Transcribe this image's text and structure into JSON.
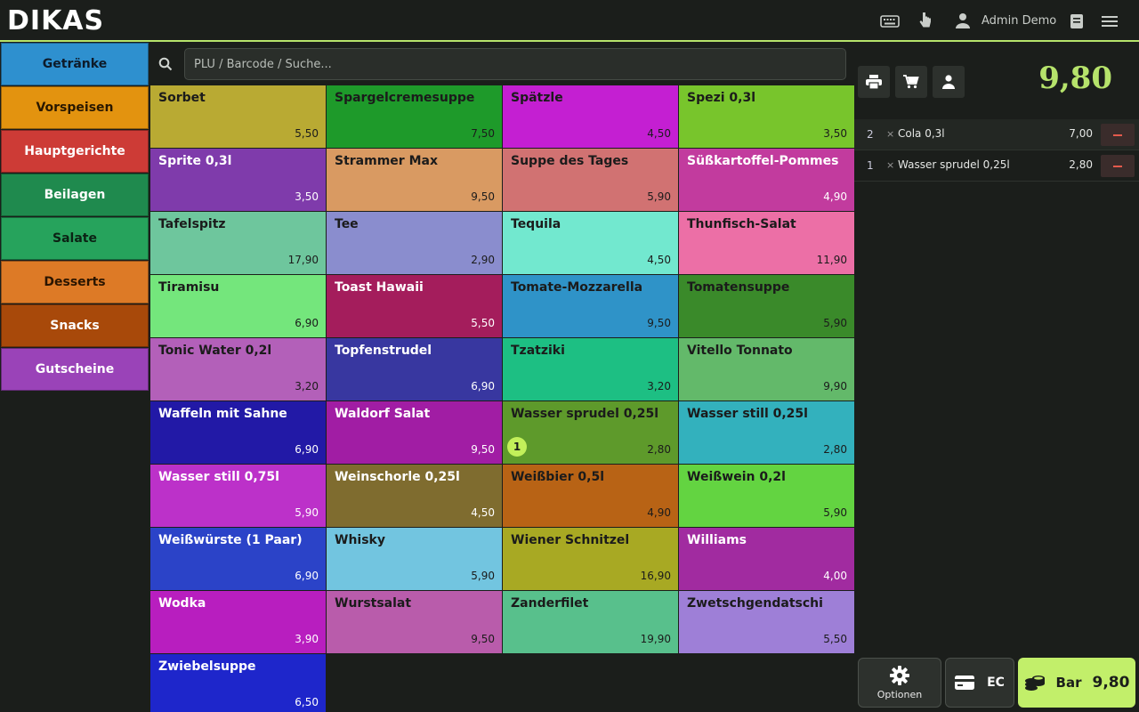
{
  "app": {
    "logo": "DIKAS",
    "user": "Admin Demo"
  },
  "colors": {
    "accent": "#b6e36b",
    "background": "#1b1e1b"
  },
  "categories": [
    {
      "label": "Getränke",
      "color": "#2e90cf",
      "text": "#0d1b2a"
    },
    {
      "label": "Vorspeisen",
      "color": "#e3930f",
      "text": "#2a1800"
    },
    {
      "label": "Hauptgerichte",
      "color": "#cd3b36",
      "text": "#ffffff"
    },
    {
      "label": "Beilagen",
      "color": "#1f8a4e",
      "text": "#ffffff"
    },
    {
      "label": "Salate",
      "color": "#26a35c",
      "text": "#0b2214"
    },
    {
      "label": "Desserts",
      "color": "#dd7a26",
      "text": "#2a1500"
    },
    {
      "label": "Snacks",
      "color": "#a8490a",
      "text": "#ffffff"
    },
    {
      "label": "Gutscheine",
      "color": "#9a43b8",
      "text": "#ffffff"
    }
  ],
  "search": {
    "placeholder": "PLU / Barcode / Suche..."
  },
  "products": [
    {
      "name": "Sorbet",
      "price": "5,50",
      "color": "#b9aa33",
      "text": "#1b1b1b"
    },
    {
      "name": "Spargelcremesuppe",
      "price": "7,50",
      "color": "#1e9a2a",
      "text": "#1b1b1b"
    },
    {
      "name": "Spätzle",
      "price": "4,50",
      "color": "#c41fd2",
      "text": "#1b1b1b"
    },
    {
      "name": "Spezi 0,3l",
      "price": "3,50",
      "color": "#78c52c",
      "text": "#1b1b1b"
    },
    {
      "name": "Sprite 0,3l",
      "price": "3,50",
      "color": "#7f3bab",
      "text": "#ffffff"
    },
    {
      "name": "Strammer Max",
      "price": "9,50",
      "color": "#d99a62",
      "text": "#1b1b1b"
    },
    {
      "name": "Suppe des Tages",
      "price": "5,90",
      "color": "#d17272",
      "text": "#1b1b1b"
    },
    {
      "name": "Süßkartoffel-Pommes",
      "price": "4,90",
      "color": "#c23b9e",
      "text": "#ffffff"
    },
    {
      "name": "Tafelspitz",
      "price": "17,90",
      "color": "#6ec69d",
      "text": "#1b1b1b"
    },
    {
      "name": "Tee",
      "price": "2,90",
      "color": "#8a8dce",
      "text": "#1b1b1b"
    },
    {
      "name": "Tequila",
      "price": "4,50",
      "color": "#72e8cf",
      "text": "#1b1b1b"
    },
    {
      "name": "Thunfisch-Salat",
      "price": "11,90",
      "color": "#ec6fa6",
      "text": "#1b1b1b"
    },
    {
      "name": "Tiramisu",
      "price": "6,90",
      "color": "#74e67c",
      "text": "#1b1b1b"
    },
    {
      "name": "Toast Hawaii",
      "price": "5,50",
      "color": "#a41d5c",
      "text": "#ffffff"
    },
    {
      "name": "Tomate-Mozzarella",
      "price": "9,50",
      "color": "#2f93c8",
      "text": "#1b1b1b"
    },
    {
      "name": "Tomatensuppe",
      "price": "5,90",
      "color": "#3a8a2a",
      "text": "#1b1b1b"
    },
    {
      "name": "Tonic Water 0,2l",
      "price": "3,20",
      "color": "#b360b9",
      "text": "#1b1b1b"
    },
    {
      "name": "Topfenstrudel",
      "price": "6,90",
      "color": "#3837a0",
      "text": "#ffffff"
    },
    {
      "name": "Tzatziki",
      "price": "3,20",
      "color": "#1dbf83",
      "text": "#1b1b1b"
    },
    {
      "name": "Vitello Tonnato",
      "price": "9,90",
      "color": "#63b96a",
      "text": "#1b1b1b"
    },
    {
      "name": "Waffeln mit Sahne",
      "price": "6,90",
      "color": "#2219a6",
      "text": "#ffffff"
    },
    {
      "name": "Waldorf Salat",
      "price": "9,50",
      "color": "#a11da4",
      "text": "#ffffff"
    },
    {
      "name": "Wasser sprudel 0,25l",
      "price": "2,80",
      "color": "#5e9a2b",
      "text": "#1b1b1b",
      "badge": "1"
    },
    {
      "name": "Wasser still 0,25l",
      "price": "2,80",
      "color": "#33b1bd",
      "text": "#1b1b1b"
    },
    {
      "name": "Wasser still 0,75l",
      "price": "5,90",
      "color": "#bc31c9",
      "text": "#ffffff"
    },
    {
      "name": "Weinschorle 0,25l",
      "price": "4,50",
      "color": "#7f6c2f",
      "text": "#ffffff"
    },
    {
      "name": "Weißbier 0,5l",
      "price": "4,90",
      "color": "#b86315",
      "text": "#1b1b1b"
    },
    {
      "name": "Weißwein 0,2l",
      "price": "5,90",
      "color": "#63d441",
      "text": "#1b1b1b"
    },
    {
      "name": "Weißwürste (1 Paar)",
      "price": "6,90",
      "color": "#2b43c8",
      "text": "#ffffff"
    },
    {
      "name": "Whisky",
      "price": "5,90",
      "color": "#72c5e0",
      "text": "#1b1b1b"
    },
    {
      "name": "Wiener Schnitzel",
      "price": "16,90",
      "color": "#a8a923",
      "text": "#1b1b1b"
    },
    {
      "name": "Williams",
      "price": "4,00",
      "color": "#a12ba0",
      "text": "#ffffff"
    },
    {
      "name": "Wodka",
      "price": "3,90",
      "color": "#b81ebf",
      "text": "#ffffff"
    },
    {
      "name": "Wurstsalat",
      "price": "9,50",
      "color": "#b95cab",
      "text": "#1b1b1b"
    },
    {
      "name": "Zanderfilet",
      "price": "19,90",
      "color": "#58c08c",
      "text": "#1b1b1b"
    },
    {
      "name": "Zwetschgendatschi",
      "price": "5,50",
      "color": "#9e7fd7",
      "text": "#1b1b1b"
    },
    {
      "name": "Zwiebelsuppe",
      "price": "6,50",
      "color": "#1e26cb",
      "text": "#ffffff"
    }
  ],
  "order": {
    "total": "9,80",
    "items": [
      {
        "qty": "2",
        "x": "×",
        "name": "Cola 0,3l",
        "price": "7,00"
      },
      {
        "qty": "1",
        "x": "×",
        "name": "Wasser sprudel 0,25l",
        "price": "2,80"
      }
    ]
  },
  "actions": {
    "options_label": "Optionen",
    "ec_label": "EC",
    "cash_label": "Bar",
    "cash_amount": "9,80"
  },
  "icons": [
    "keyboard-icon",
    "hand-pointer-icon",
    "user-icon",
    "book-icon",
    "menu-icon",
    "search-icon",
    "printer-icon",
    "cart-icon",
    "customer-icon",
    "gear-icon",
    "card-icon",
    "coins-icon"
  ]
}
